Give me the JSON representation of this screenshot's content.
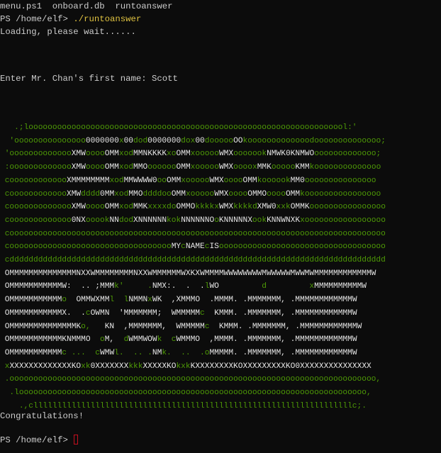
{
  "terminal": {
    "listing": "menu.ps1  onboard.db  runtoanswer",
    "prompt1": "PS /home/elf> ",
    "command1": "./runtoanswer",
    "loading": "Loading, please wait......",
    "question": "Enter Mr. Chan's first name: Scott",
    "art": [
      "   .;looooooooooooooooooooooooooooooooooooooooooooooooooooooooooooooooool:'",
      "  'ooooooooooooooo0000000x00dod0000000dox00doooooOOkooooooooooooodoooooooooooooo;",
      " 'oooooooooooooXMWooooOMMxodMMNKKKKxoOMMxoooooWMXooooookNMWK0KNMWOooooooooooooo;",
      " :oooooooooooooXMWooooOMMxodMMOooooooOMMxoooooWMXooooxMMKoooooKMMkoooooooooooooo",
      " cooooooooooooXMMMMMMMMxodMMWWWW0ooOMMxoooooWMXooooOMMkoooookMM0ooooooooooooooo",
      " cooooooooooooXMWdddd0MMxodMMOddddooOMMxoooooWMXooooOMMOooooOMMkoooooooooooooooo",
      " coooooooooooooXMWooooOMMxodMMKxxxxdoOMMOkkkkxWMXkkkkdXMW0xxkOMMKoooooooooooooooo",
      " cooooooooooooo0NXooookNNdodXNNNNNNkokNNNNNNOoKNNNNNXookKNNWNXKxooooooooooooooooo",
      " cooooooooooooooooooooooooooooooooooooooooooooooooooooooooooooooooooooooooooooooo",
      " cooooooooooooooooooooooooooooooooooMYcNAMEcISooooooooooooooooooooooooooooooooooo",
      " cddddddddddddddddddddddddddddddddddddddddddddddddddddddddddddddddddddddddddddddd",
      " OMMMMMMMMMMMMMMNXXWMMMMMMMMNXXWMMMMMMWXKXWMMMMWWWWWWWWMWWWWWMWWMWMMMMMMMMMMMMW",
      " OMMMMMMMMMMMW:  .. ;MMMk'     .NMX:.  .  .lWO         d         xMMMMMMMMMMW",
      " OMMMMMMMMMMMo  OMMWXMMl  lNMMNxWK  ,XMMMO  .MMMM. .MMMMMMM, .MMMMMMMMMMMMW",
      " OMMMMMMMMMMMX.  .cOWMN  'MMMMMMM;  WMMMMMc  KMMM. .MMMMMMM, .MMMMMMMMMMMMW",
      " OMMMMMMMMMMMMMMKo,   KN  ,MMMMMMM,  WMMMMMc  KMMM. .MMMMMMM, .MMMMMMMMMMMMW",
      " OMMMMMMMMMMMKNMMMO  oM,  dWMMWOWk  cWMMMO  ,MMMM. .MMMMMMM, .MMMMMMMMMMMMW",
      " OMMMMMMMMMMMc ...  cWMWl.  .. .NMk.  ..  .oMMMMM. .MMMMMMM, .MMMMMMMMMMMMW",
      " xXXXXXXXXXXXXXKOxk0XXXXXXXkkkXXXXXKOkxkKXXXXXXXXKOXXXXXXXXXKO0XXXXXXXXXXXXXXX",
      " .ooooooooooooooooooooooooooooooooooooooooooooooooooooooooooooooooooooooooooooo,",
      "  .looooooooooooooooooooooooooooooooooooooooooooooooooooooooooooooooooooooooo,",
      "    .,clllllllllllllllllllllllllllllllllllllllllllllllllllllllllllllllllllc;."
    ],
    "congrats": "Congratulations!",
    "prompt2": "PS /home/elf> "
  },
  "colors": {
    "background": "#0c0c0c",
    "text": "#cccccc",
    "command": "#e0c341",
    "art_green": "#4e9a06",
    "art_white": "#e6e6e6",
    "cursor": "#c50f1f"
  }
}
